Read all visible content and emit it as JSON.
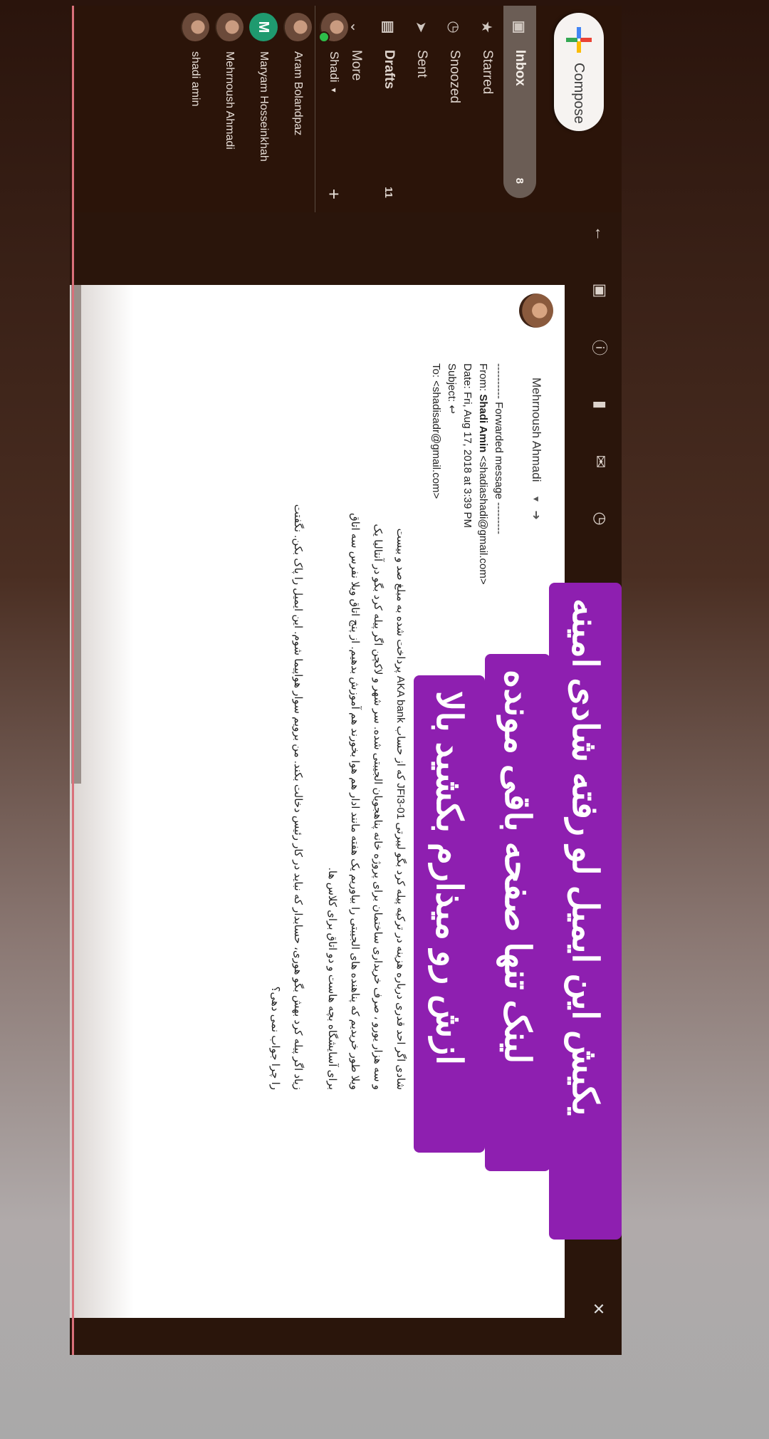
{
  "sidebar": {
    "compose_label": "Compose",
    "items": [
      {
        "label": "Inbox",
        "count": "8",
        "icon": "inbox-icon",
        "active": true
      },
      {
        "label": "Starred",
        "count": "",
        "icon": "star-icon"
      },
      {
        "label": "Snoozed",
        "count": "",
        "icon": "clock-icon"
      },
      {
        "label": "Sent",
        "count": "",
        "icon": "send-icon"
      },
      {
        "label": "Drafts",
        "count": "11",
        "icon": "draft-icon"
      },
      {
        "label": "More",
        "count": "",
        "icon": "chevron-down-icon"
      }
    ],
    "hangouts_user": "Shadi",
    "contacts": [
      {
        "name": "Aram Bolandpaz"
      },
      {
        "name": "Maryam Hosseinkhah",
        "initial": "M"
      },
      {
        "name": "Mehrnoush Ahmadi"
      },
      {
        "name": "shadi amin"
      }
    ]
  },
  "message": {
    "sender": "Mehrnoush Ahmadi",
    "forwarded": "---------- Forwarded message ---------",
    "from_label": "From:",
    "from_name": "Shadi Amin",
    "from_email": "<shadiashadi@gmail.com>",
    "date": "Date: Fri, Aug 17, 2018 at 3:39 PM",
    "subject": "Subject: ↩",
    "to": "To: <shadisadr@gmail.com>",
    "body": [
      "شادی اگر احد قدری درباره هزینه در ترکیه پیله کرد بگو لیبرتی JFI3-01 که از حساب AKA bank پرداخت شده به مبلغ صد و بیست",
      "و سه هزار یورو ، صرف خریداری ساختمان برای پروژه خانه پناهجویان الجیبتی شده. سر شهر و لاکچن اگر پیله کرد بگو در آنتالیا یک",
      "ویلا طور خریدیم که پناهنده های الجیبتی را بیاوریم یک هفته مانند ادار هم هوا بخورند هم آموزش بدهیم. از پنج اتاق ویلا نفرس سه اتاق",
      "برای آسایشگاه بچه هاست و دو اتاق برای کلاس ها.",
      "زیاد اگر پیله کرد بهش بگو هوری، حسابدار که نباید در کار رئیس دخالت بکند. من برویم سوار هواپیما شوم. این ایمیل را پاک بکن. نگفتت",
      "را چرا جواب نمی دهی؟"
    ]
  },
  "overlay": {
    "line1": "یکیش این ایمیل لو رفته شادی امینه",
    "line2": "لینک تنها صفحه باقی مونده",
    "line3": "ازش رو میذارم بکشید بالا"
  },
  "colors": {
    "banner": "#8e1fb0",
    "sidebar": "#2b1409",
    "card": "#ffffff"
  }
}
